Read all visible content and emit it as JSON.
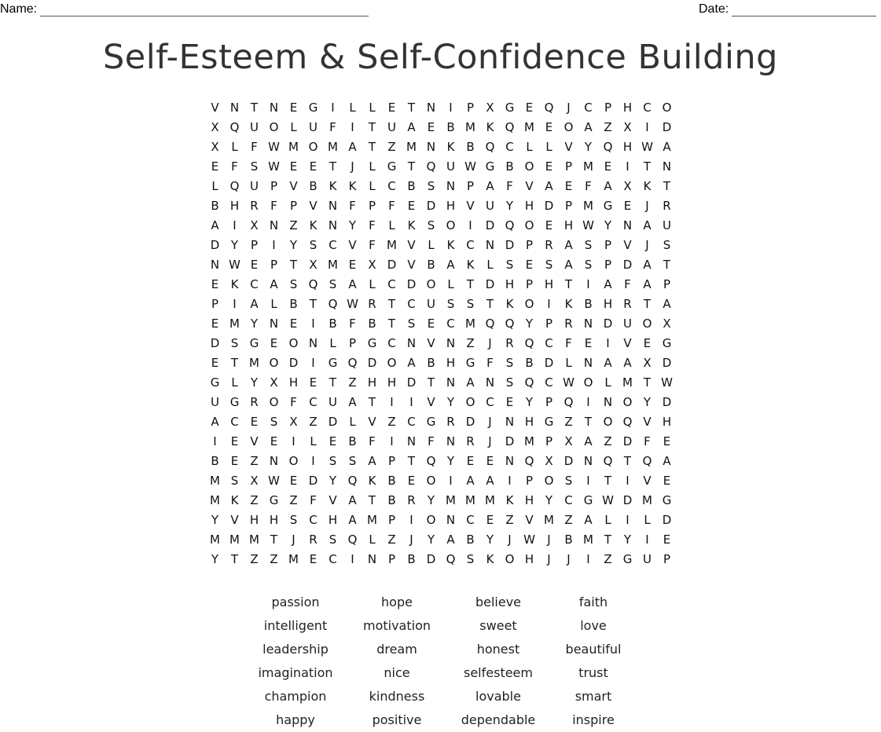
{
  "header": {
    "name_label": "Name:",
    "date_label": "Date:"
  },
  "title": "Self-Esteem & Self-Confidence Building",
  "grid": [
    "VNTNEGILLETNIPXGEQJCPHCO",
    "XQUOLUFITUAEBMKQMEOAZXID",
    "XLFWMOMATZMNKBQCLLVYQHWA",
    "EFSWEETJLGTQUWGBOEPMEITN",
    "LQUPVBKKLCBSNPAFVAEFAXKT",
    "BHRFPVNFPFEDHVUYHDPMGEJR",
    "AIXNZKNYFLKSOIDQOEHWYNAU",
    "DYPIYSCVFMVLKCNDPRASPVJS",
    "NWEPTXMEXDVBAKLSESASPDAT",
    "EKCASQSALCDOLTDHPHTIAFAP",
    "PIALBTQWRTCUSSTKOIKBHRTA",
    "EMYNEIBFBTSECMQQYPRNDUOX",
    "DSGEONLPGCNVNZJRQCFEIVEG",
    "ETMODIGQDOABHGFSBDLNAAXD",
    "GLYXHETZHHDTNANSQCWOLMTW",
    "UGROFCUATIIVYOCEYPQINOYD",
    "ACESXZDLVZCGRDJNHGZTOQVH",
    "IEVEILEBFINFNRJDMPXAZDFE",
    "BEZNOISSAPTQYEENQXDNQTQA",
    "MSXWEDYQKBEOIAAIPOSITIVE",
    "MKZGZFVATBRYMMMKHYCGWDMG",
    "YVHHSCHAMPIONCEZVMZALILD",
    "MMMTJRSQLZJYABYJWJBMTYIE",
    "YTZZMECINPBDQSKOHJJIZGUP"
  ],
  "word_list": [
    "passion",
    "hope",
    "believe",
    "faith",
    "intelligent",
    "motivation",
    "sweet",
    "love",
    "leadership",
    "dream",
    "honest",
    "beautiful",
    "imagination",
    "nice",
    "selfesteem",
    "trust",
    "champion",
    "kindness",
    "lovable",
    "smart",
    "happy",
    "positive",
    "dependable",
    "inspire"
  ]
}
